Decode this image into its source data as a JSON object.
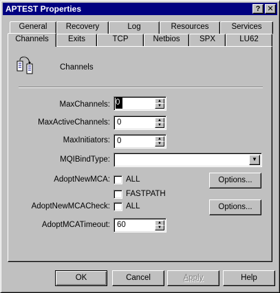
{
  "window": {
    "title": "APTEST Properties",
    "help_button": "?",
    "close_button": "✕"
  },
  "tabs": {
    "back_row": [
      "General",
      "Recovery",
      "Log",
      "Resources",
      "Services"
    ],
    "front_row": [
      "Channels",
      "Exits",
      "TCP",
      "Netbios",
      "SPX",
      "LU62"
    ],
    "active": "Channels"
  },
  "panel": {
    "heading": "Channels",
    "heading_icon": "channels-icon",
    "fields": {
      "max_channels": {
        "label": "MaxChannels:",
        "value": "0"
      },
      "max_active_channels": {
        "label": "MaxActiveChannels:",
        "value": "0"
      },
      "max_initiators": {
        "label": "MaxInitiators:",
        "value": "0"
      },
      "mqi_bind_type": {
        "label": "MQIBindType:",
        "value": ""
      },
      "adopt_new_mca": {
        "label": "AdoptNewMCA:",
        "all_label": "ALL",
        "fastpath_label": "FASTPATH",
        "options_label": "Options..."
      },
      "adopt_new_mca_check": {
        "label": "AdoptNewMCACheck:",
        "all_label": "ALL",
        "options_label": "Options..."
      },
      "adopt_mca_timeout": {
        "label": "AdoptMCATimeout:",
        "value": "60"
      }
    }
  },
  "buttons": {
    "ok": "OK",
    "cancel": "Cancel",
    "apply": "Apply",
    "help": "Help"
  },
  "colors": {
    "titlebar": "#000080",
    "face": "#c0c0c0"
  }
}
